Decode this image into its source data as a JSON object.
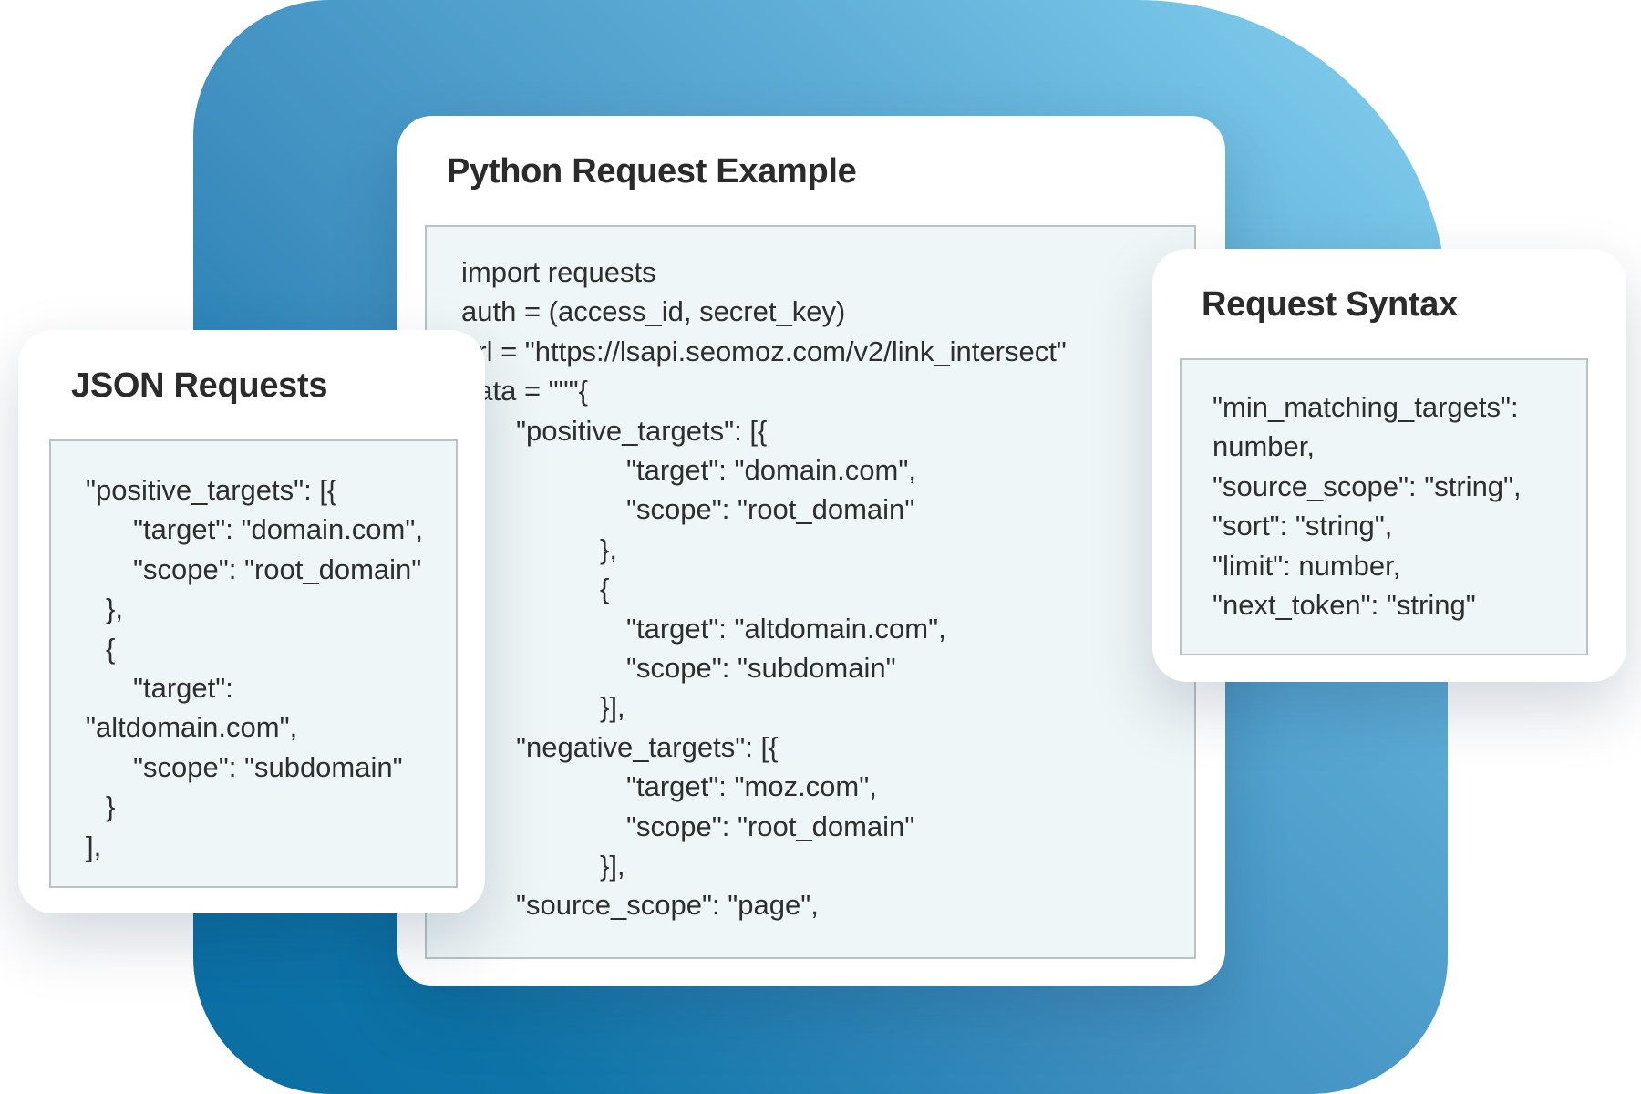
{
  "python_card": {
    "title": "Python Request Example",
    "lines": [
      "import requests",
      "auth = (access_id, secret_key)",
      "url = \"https://lsapi.seomoz.com/v2/link_intersect\"",
      "data = \"\"\"{",
      "\"positive_targets\": [{",
      "\"target\": \"domain.com\",",
      "\"scope\": \"root_domain\"",
      "},",
      "{",
      "\"target\": \"altdomain.com\",",
      "\"scope\": \"subdomain\"",
      "}],",
      "\"negative_targets\": [{",
      "\"target\": \"moz.com\",",
      "\"scope\": \"root_domain\"",
      "}],",
      "\"source_scope\": \"page\","
    ]
  },
  "json_card": {
    "title": "JSON Requests",
    "lines": [
      "\"positive_targets\": [{",
      "\"target\": \"domain.com\",",
      "\"scope\": \"root_domain\"",
      "},",
      "{",
      "\"target\":",
      "\"altdomain.com\",",
      "\"scope\": \"subdomain\"",
      "}",
      "],"
    ]
  },
  "syntax_card": {
    "title": "Request Syntax",
    "lines": [
      "\"min_matching_targets\":",
      "number,",
      "\"source_scope\": \"string\",",
      "\"sort\": \"string\",",
      "\"limit\": number,",
      "\"next_token\": \"string\""
    ]
  }
}
